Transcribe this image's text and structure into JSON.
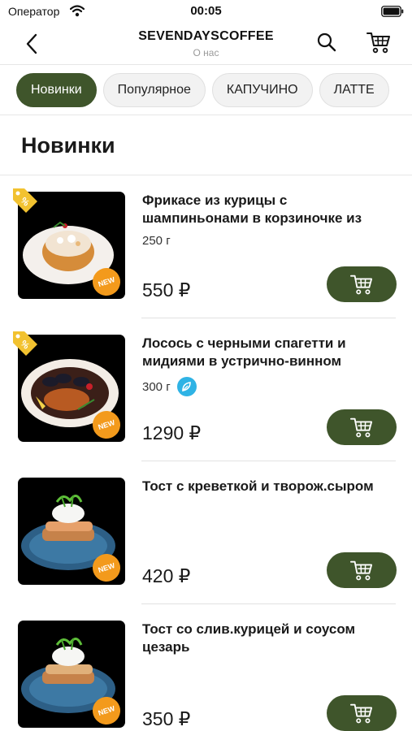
{
  "status_bar": {
    "carrier": "Оператор",
    "time": "00:05"
  },
  "nav": {
    "title": "SEVENDAYSCOFFEE",
    "subtitle": "О нас"
  },
  "categories": [
    {
      "label": "Новинки",
      "active": true
    },
    {
      "label": "Популярное",
      "active": false
    },
    {
      "label": "КАПУЧИНО",
      "active": false
    },
    {
      "label": "ЛАТТЕ",
      "active": false
    }
  ],
  "section": {
    "title": "Новинки"
  },
  "badges": {
    "new": "NEW"
  },
  "products": [
    {
      "name": "Фрикасе из курицы с шампиньонами в корзиночке из",
      "weight": "250 г",
      "price": "550 ₽",
      "discount": true,
      "vegetarian": false
    },
    {
      "name": "Лосось с черными спагетти и мидиями в устрично-винном",
      "weight": "300 г",
      "price": "1290 ₽",
      "discount": true,
      "vegetarian": true
    },
    {
      "name": "Тост с креветкой и творож.сыром",
      "weight": "",
      "price": "420 ₽",
      "discount": false,
      "vegetarian": false
    },
    {
      "name": "Тост со слив.курицей и соусом цезарь",
      "weight": "",
      "price": "350 ₽",
      "discount": false,
      "vegetarian": false
    }
  ],
  "colors": {
    "accent": "#3f552b",
    "new_badge": "#f39a1c",
    "discount_tag": "#f2c230",
    "veg_badge": "#2fb3e5"
  },
  "icons": [
    "back-chevron-icon",
    "search-icon",
    "cart-icon",
    "wifi-icon",
    "battery-icon",
    "discount-tag-icon",
    "vegetarian-icon"
  ]
}
